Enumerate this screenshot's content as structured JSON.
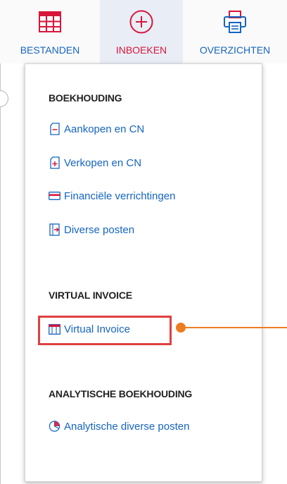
{
  "toolbar": {
    "items": [
      {
        "label": "BESTANDEN",
        "icon": "table-grid-icon",
        "color": "#d8163a"
      },
      {
        "label": "INBOEKEN",
        "icon": "plus-circle-icon",
        "color": "#d8163a",
        "active": true
      },
      {
        "label": "OVERZICHTEN",
        "icon": "printer-icon",
        "color": "#1565c0"
      }
    ]
  },
  "menu": {
    "sections": [
      {
        "title": "BOEKHOUDING",
        "items": [
          {
            "label": "Aankopen en CN",
            "icon": "purchase-document-icon"
          },
          {
            "label": "Verkopen en CN",
            "icon": "sales-document-icon"
          },
          {
            "label": "Financiële verrichtingen",
            "icon": "credit-card-icon"
          },
          {
            "label": "Diverse posten",
            "icon": "document-arrow-icon"
          }
        ]
      },
      {
        "title": "VIRTUAL INVOICE",
        "items": [
          {
            "label": "Virtual Invoice",
            "icon": "invoice-window-icon",
            "highlighted": true
          }
        ]
      },
      {
        "title": "ANALYTISCHE BOEKHOUDING",
        "items": [
          {
            "label": "Analytische diverse posten",
            "icon": "pie-chart-icon"
          }
        ]
      }
    ]
  },
  "colors": {
    "accent_red": "#d8163a",
    "link_blue": "#1565c0",
    "highlight_border": "#e04040",
    "callout_orange": "#ee7d22"
  }
}
